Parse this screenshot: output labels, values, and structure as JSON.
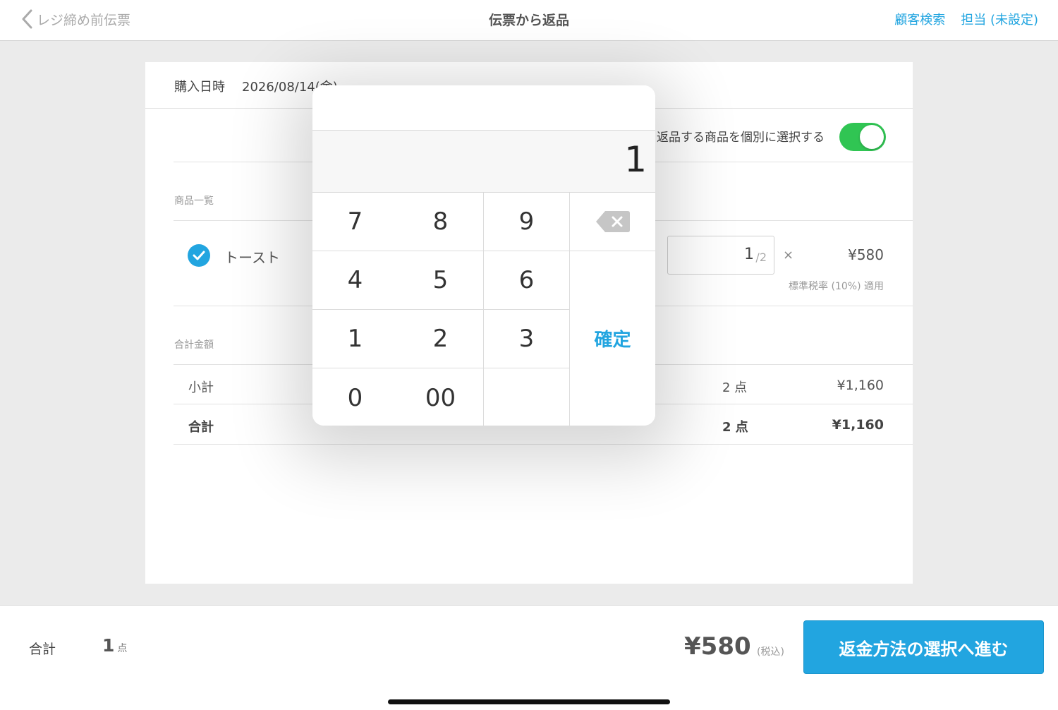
{
  "nav": {
    "back_label": "レジ締め前伝票",
    "title": "伝票から返品",
    "customer_search": "顧客検索",
    "staff": "担当 (未設定)"
  },
  "slip": {
    "date_label": "購入日時",
    "date_value": "2026/08/14(金)",
    "toggle_label": "返品する商品を個別に選択する",
    "toggle_on": true
  },
  "items_section": {
    "label": "商品一覧",
    "items": [
      {
        "checked": true,
        "name": "トースト",
        "qty": "1",
        "qty_max": "/2",
        "times": "×",
        "price": "¥580",
        "tax_note": "標準税率 (10%) 適用"
      }
    ]
  },
  "totals_section": {
    "label": "合計金額",
    "subtotal": {
      "label": "小計",
      "count": "2 点",
      "amount": "¥1,160"
    },
    "total": {
      "label": "合計",
      "count": "2 点",
      "amount": "¥1,160"
    }
  },
  "bottom": {
    "label": "合計",
    "count": "1",
    "count_unit": "点",
    "amount": "¥580",
    "tax_note": "(税込)",
    "proceed_button": "返金方法の選択へ進む"
  },
  "keypad": {
    "display": "1",
    "keys": [
      "7",
      "8",
      "9",
      "4",
      "5",
      "6",
      "1",
      "2",
      "3",
      "0",
      "00"
    ],
    "confirm": "確定"
  },
  "colors": {
    "accent": "#22a5e0",
    "toggle_on": "#30c553"
  }
}
